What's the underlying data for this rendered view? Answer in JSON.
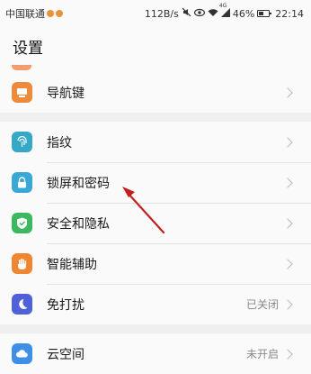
{
  "status_bar": {
    "carrier": "中国联通",
    "speed": "112B/s",
    "signal_label": "4G",
    "battery_percent": "46%",
    "battery_level": 0.46,
    "time": "22:14",
    "icons": [
      "carrier-badge-icon",
      "mute-icon",
      "eye-icon",
      "wifi-icon",
      "signal-icon",
      "battery-icon"
    ]
  },
  "header": {
    "title": "设置"
  },
  "groups": [
    {
      "items": [
        {
          "label": "导航键",
          "icon": "navigation-key-icon",
          "color": "#ee8a3c"
        }
      ]
    },
    {
      "items": [
        {
          "label": "指纹",
          "icon": "fingerprint-icon",
          "color": "#35a8c8"
        },
        {
          "label": "锁屏和密码",
          "icon": "lock-icon",
          "color": "#3aa8d6"
        },
        {
          "label": "安全和隐私",
          "icon": "shield-check-icon",
          "color": "#3cb860"
        },
        {
          "label": "智能辅助",
          "icon": "hand-icon",
          "color": "#f08632"
        },
        {
          "label": "免打扰",
          "icon": "moon-icon",
          "color": "#5060d8",
          "value": "已关闭"
        }
      ]
    },
    {
      "items": [
        {
          "label": "云空间",
          "icon": "cloud-icon",
          "color": "#3e8fe6",
          "value": "未开启"
        }
      ]
    }
  ],
  "annotation": {
    "icon": "red-arrow-icon",
    "color": "#c41f1f"
  }
}
